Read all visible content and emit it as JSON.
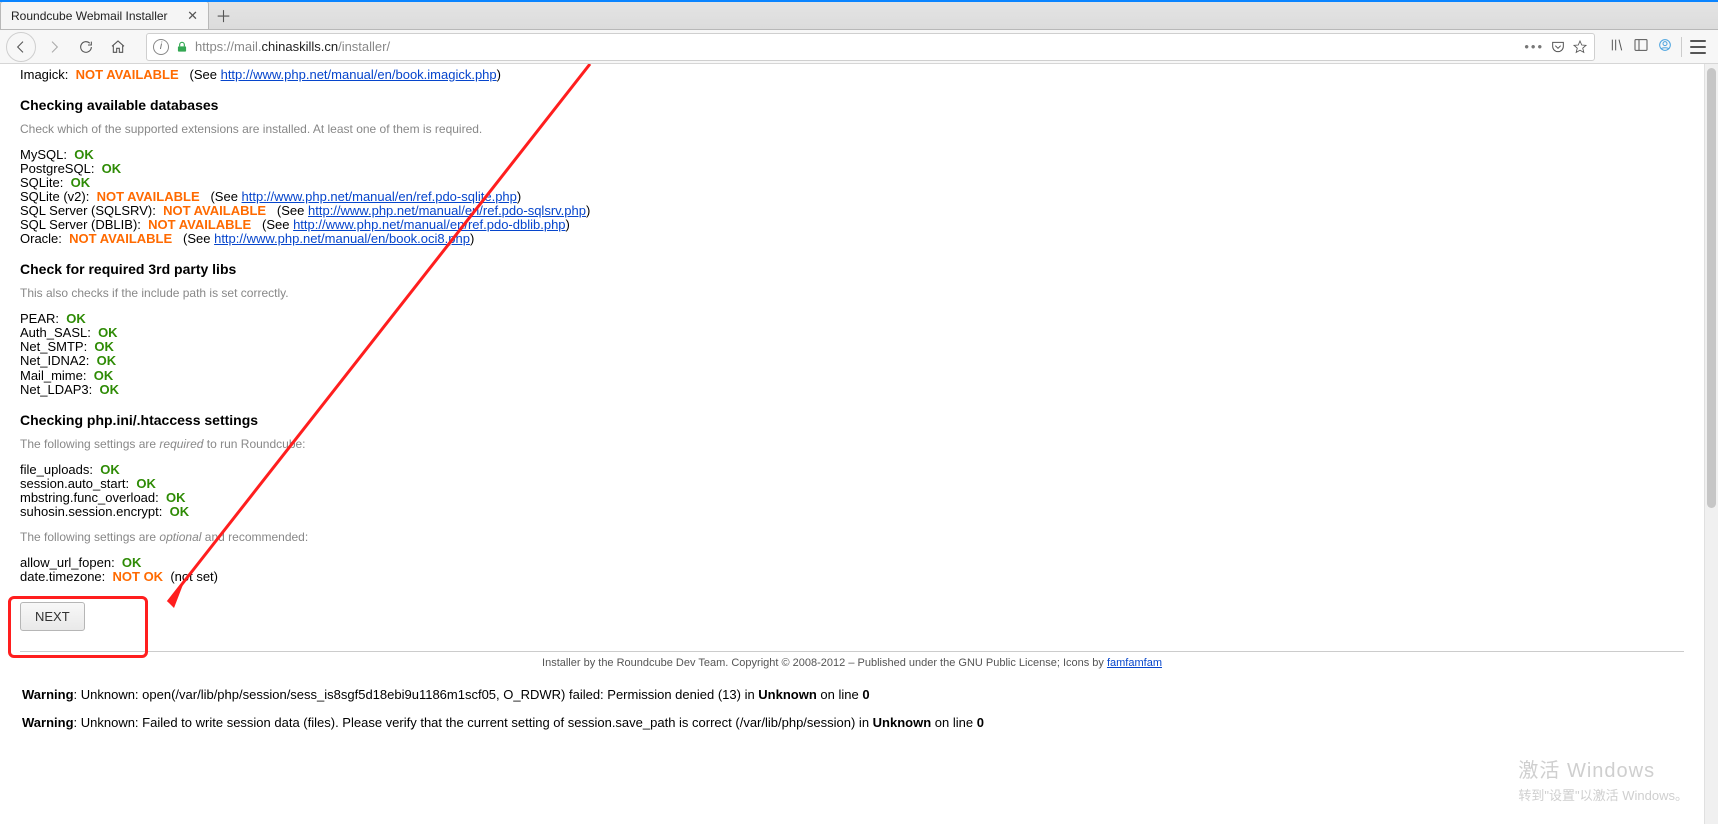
{
  "browser": {
    "tab_title": "Roundcube Webmail Installer",
    "url_proto": "https://",
    "url_host_sub": "mail.",
    "url_host_main": "chinaskills.cn",
    "url_path": "/installer/"
  },
  "imagick": {
    "label": "Imagick:",
    "status": "NOT AVAILABLE",
    "see": "(See ",
    "link": "http://www.php.net/manual/en/book.imagick.php",
    "tail": ")"
  },
  "db_section": {
    "title": "Checking available databases",
    "desc": "Check which of the supported extensions are installed. At least one of them is required.",
    "items": [
      {
        "label": "MySQL:",
        "ok": true,
        "status": "OK"
      },
      {
        "label": "PostgreSQL:",
        "ok": true,
        "status": "OK"
      },
      {
        "label": "SQLite:",
        "ok": true,
        "status": "OK"
      },
      {
        "label": "SQLite (v2):",
        "ok": false,
        "status": "NOT AVAILABLE",
        "link": "http://www.php.net/manual/en/ref.pdo-sqlite.php"
      },
      {
        "label": "SQL Server (SQLSRV):",
        "ok": false,
        "status": "NOT AVAILABLE",
        "link": "http://www.php.net/manual/en/ref.pdo-sqlsrv.php"
      },
      {
        "label": "SQL Server (DBLIB):",
        "ok": false,
        "status": "NOT AVAILABLE",
        "link": "http://www.php.net/manual/en/ref.pdo-dblib.php"
      },
      {
        "label": "Oracle:",
        "ok": false,
        "status": "NOT AVAILABLE",
        "link": "http://www.php.net/manual/en/book.oci8.php"
      }
    ]
  },
  "libs_section": {
    "title": "Check for required 3rd party libs",
    "desc": "This also checks if the include path is set correctly.",
    "items": [
      {
        "label": "PEAR:",
        "status": "OK"
      },
      {
        "label": "Auth_SASL:",
        "status": "OK"
      },
      {
        "label": "Net_SMTP:",
        "status": "OK"
      },
      {
        "label": "Net_IDNA2:",
        "status": "OK"
      },
      {
        "label": "Mail_mime:",
        "status": "OK"
      },
      {
        "label": "Net_LDAP3:",
        "status": "OK"
      }
    ]
  },
  "ini_section": {
    "title": "Checking php.ini/.htaccess settings",
    "desc_req_a": "The following settings are ",
    "desc_req_i": "required",
    "desc_req_b": " to run Roundcube:",
    "req_items": [
      {
        "label": "file_uploads:",
        "status": "OK"
      },
      {
        "label": "session.auto_start:",
        "status": "OK"
      },
      {
        "label": "mbstring.func_overload:",
        "status": "OK"
      },
      {
        "label": "suhosin.session.encrypt:",
        "status": "OK"
      }
    ],
    "desc_opt_a": "The following settings are ",
    "desc_opt_i": "optional",
    "desc_opt_b": " and recommended:",
    "opt_items": [
      {
        "label": "allow_url_fopen:",
        "ok": true,
        "status": "OK",
        "tail": ""
      },
      {
        "label": "date.timezone:",
        "ok": false,
        "status": "NOT OK",
        "tail": "(not set)"
      }
    ]
  },
  "next_label": "NEXT",
  "footer": {
    "text_a": "Installer by the Roundcube Dev Team. Copyright © 2008-2012 – Published under the GNU Public License;  Icons by ",
    "link": "famfamfam"
  },
  "warnings": [
    {
      "b": "Warning",
      "mid": ": Unknown: open(/var/lib/php/session/sess_is8sgf5d18ebi9u1186m1scf05, O_RDWR) failed: Permission denied (13) in ",
      "b2": "Unknown",
      "mid2": " on line ",
      "b3": "0"
    },
    {
      "b": "Warning",
      "mid": ": Unknown: Failed to write session data (files). Please verify that the current setting of session.save_path is correct (/var/lib/php/session) in ",
      "b2": "Unknown",
      "mid2": " on line ",
      "b3": "0"
    }
  ],
  "watermark": {
    "line1": "激活 Windows",
    "line2": "转到\"设置\"以激活 Windows。"
  }
}
